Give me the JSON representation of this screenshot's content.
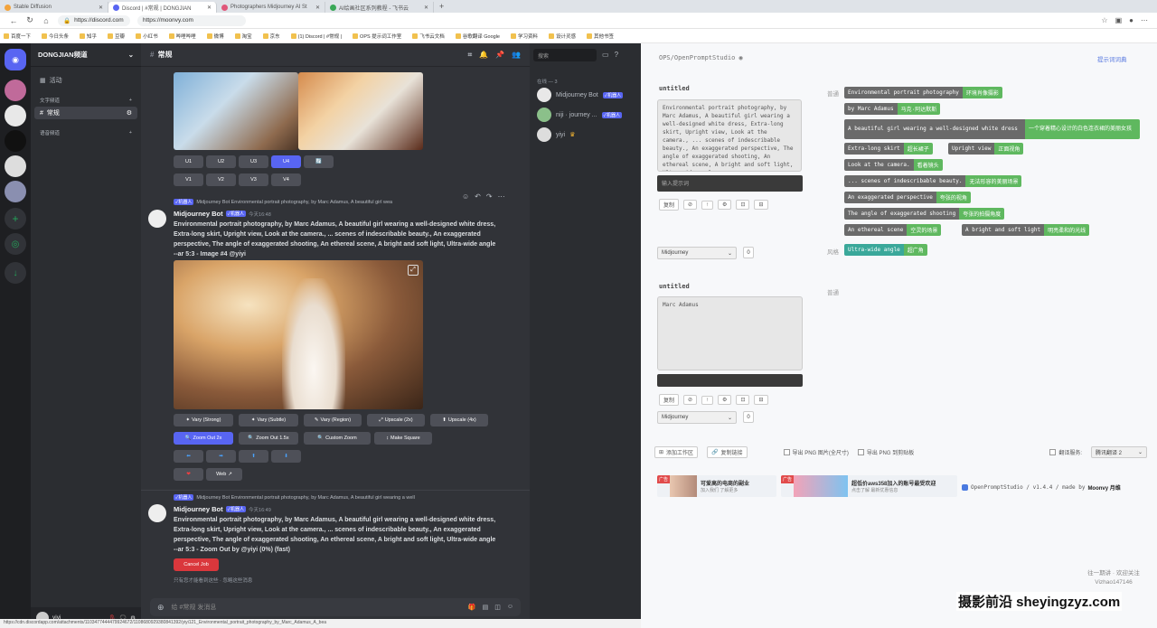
{
  "browser": {
    "tabs": [
      {
        "label": "Stable Diffusion",
        "color": "#f3a33b"
      },
      {
        "label": "Discord | #常规 | DONGJIAN",
        "color": "#5865f2"
      },
      {
        "label": "Photographers Midjourney AI St",
        "color": "#e0577a"
      },
      {
        "label": "AI绘画社区系列教程 - 飞书云",
        "color": "#3aa857"
      }
    ],
    "url_left": "https://discord.com",
    "url_right": "https://moonvy.com",
    "bookmarks": [
      "百度一下",
      "今日头条",
      "知乎",
      "豆瓣",
      "小红书",
      "哔哩哔哩",
      "微博",
      "淘宝",
      "京东",
      "(1) Discord | #常规 |",
      "OPS 提示词工作室",
      "飞书云文档",
      "谷歌翻译 Google",
      "学习资料",
      "设计灵感",
      "其他书签"
    ]
  },
  "discord": {
    "server_name": "DONGJIAN频道",
    "channel_header": "常规",
    "events_label": "活动",
    "text_category": "文字频道",
    "channel_name": "常规",
    "voice_category": "语音频道",
    "upscale_buttons": [
      "U1",
      "U2",
      "U3",
      "U4"
    ],
    "variation_buttons": [
      "V1",
      "V2",
      "V3",
      "V4"
    ],
    "bot_name": "Midjourney Bot",
    "bot_badge": "✓机器人",
    "time1": "今天16:48",
    "time2": "今天16:49",
    "reply1": "Midjourney Bot Environmental portrait photography, by Marc Adamus, A beautiful girl wea",
    "reply2": "Midjourney Bot Environmental portrait photography, by Marc Adamus, A beautiful girl wearing a well",
    "message1": "Environmental portrait photography, by Marc Adamus, A beautiful girl wearing a well-designed white dress, Extra-long skirt, Upright view, Look at the camera., ... scenes of indescribable beauty., An exaggerated perspective, The angle of exaggerated shooting, An ethereal scene, A bright and soft light, Ultra-wide angle --ar 5:3 - Image #4 @yiyi",
    "message2": "Environmental portrait photography, by Marc Adamus, A beautiful girl wearing a well-designed white dress, Extra-long skirt, Upright view, Look at the camera., ... scenes of indescribable beauty., An exaggerated perspective, The angle of exaggerated shooting, An ethereal scene, A bright and soft light, Ultra-wide angle --ar 5:3 - Zoom Out by @yiyi (0%) (fast)",
    "action_row1": [
      "Vary (Strong)",
      "Vary (Subtle)",
      "Vary (Region)",
      "Upscale (2x)",
      "Upscale (4x)"
    ],
    "action_row2": [
      "Zoom Out 2x",
      "Zoom Out 1.5x",
      "Custom Zoom",
      "Make Square"
    ],
    "web_label": "Web",
    "cancel_label": "Cancel Job",
    "only_you": "只有您才能看到这些 · 忽略这些消息",
    "input_placeholder": "给 #常规 发消息",
    "search_placeholder": "搜索",
    "online_header": "在线 — 3",
    "members": [
      "Midjourney Bot",
      "niji · journey ...",
      "yiyi"
    ],
    "member_badge": "✓机器人",
    "username": "yiyi",
    "status_url": "https://cdn.discordapp.com/attachments/1103477444479924672/1108680929380841392/yiyi121_Environmental_portrait_photography_by_Marc_Adamus_A_bea"
  },
  "ops": {
    "brand": "OPS/OpenPromptStudio",
    "right_link": "提示词词典",
    "section1_title": "untitled",
    "prompt1": "Environmental portrait photography, by Marc Adamus, A beautiful girl wearing a well-designed white dress, Extra-long skirt, Upright view, Look at the camera., ... scenes of indescribable beauty., An exaggerated perspective, The angle of exaggerated shooting, An ethereal scene, A bright and soft light, Ultra-wide angle",
    "input_placeholder": "输入提示词",
    "tool_labels": [
      "复制",
      "⊘",
      "↑",
      "⚙",
      "⊡",
      "⊟"
    ],
    "model_select": "Midjourney",
    "count": "0",
    "label_common": "普通",
    "label_style": "风格",
    "label_common2": "普通",
    "tags": [
      {
        "en": "Environmental portrait photography",
        "zh": "环境肖像摄影"
      },
      {
        "en": "by Marc Adamus",
        "zh": "马克·阿达默斯"
      },
      {
        "en": "A beautiful girl wearing a well-designed white dress",
        "zh": "一个穿着精心设计的白色连衣裙的美丽女孩"
      },
      {
        "en": "Extra-long skirt",
        "zh": "超长裙子"
      },
      {
        "en": "Upright view",
        "zh": "正面视角"
      },
      {
        "en": "Look at the camera.",
        "zh": "看着镜头"
      },
      {
        "en": "... scenes of indescribable beauty.",
        "zh": "无法形容的美丽场景"
      },
      {
        "en": "An exaggerated perspective",
        "zh": "夸张的视角"
      },
      {
        "en": "The angle of exaggerated shooting",
        "zh": "夸张的拍摄角度"
      },
      {
        "en": "An ethereal scene",
        "zh": "空灵的场景"
      },
      {
        "en": "A bright and soft light",
        "zh": "明亮柔和的光线"
      }
    ],
    "style_tag": {
      "en": "Ultra-wide angle",
      "zh": "超广角"
    },
    "section2_title": "untitled",
    "prompt2": "Marc Adamus",
    "bottom": {
      "add_workspace": "添加工作区",
      "share_link": "复制链接",
      "export_png": "导出 PNG 图片(全尺寸)",
      "export_png2": "导出 PNG 到剪贴板",
      "translate_label": "翻译服务:",
      "translate_value": "腾讯翻译 2"
    },
    "ad1": "可爱高的电商的副业",
    "ad1_sub": "加入我们 了解更多",
    "ad2": "超低价aws358加入的账号最受欢迎",
    "ad2_sub": "点击了解 最新优惠信息",
    "ad2_btn": "点击立即了解更多",
    "ad_badge": "广告",
    "footer": "OpenPromptStudio / v1.4.4 / made by",
    "footer_brand": "Moonvy 月维"
  },
  "watermark": "摄影前沿 sheyingzyz.com",
  "watermark2": "往一期讲 · 欢迎关注 Vizhao147146"
}
